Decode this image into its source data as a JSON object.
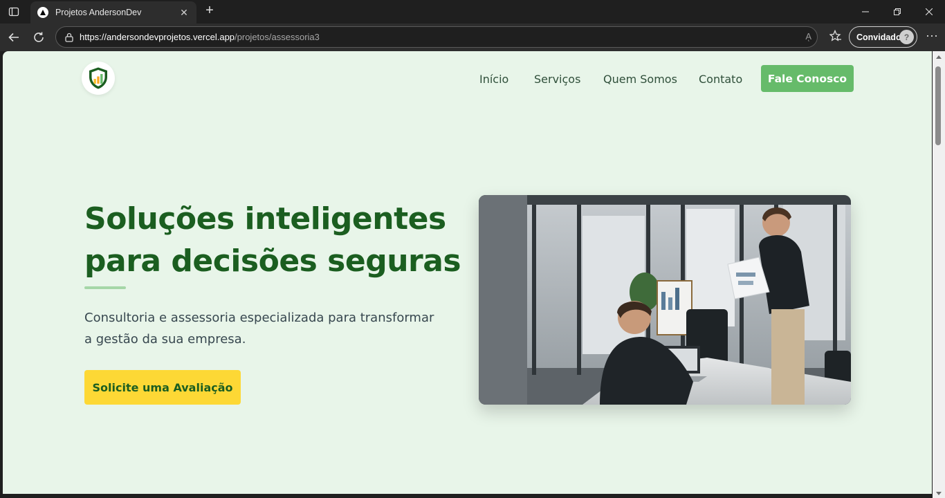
{
  "browser": {
    "tab_title": "Projetos AndersonDev",
    "url_host": "https://andersondevprojetos.vercel.app",
    "url_path": "/projetos/assessoria3",
    "read_aloud": "Aͅ",
    "profile_label": "Convidado",
    "icons": [
      "tab-actions-icon",
      "favicon-icon",
      "close-tab-icon",
      "new-tab-icon",
      "minimize-icon",
      "restore-icon",
      "close-window-icon",
      "back-icon",
      "refresh-icon",
      "lock-icon",
      "favorites-icon",
      "profile-avatar-icon",
      "more-icon"
    ]
  },
  "site": {
    "nav": {
      "items": [
        "Início",
        "Serviços",
        "Quem Somos",
        "Contato"
      ],
      "cta": "Fale Conosco"
    },
    "hero": {
      "title_line1": "Soluções inteligentes",
      "title_line2": "para decisões seguras",
      "subtitle": "Consultoria e assessoria especializada para transformar a gestão da sua empresa.",
      "button": "Solicite uma Avaliação"
    },
    "colors": {
      "background": "#e8f5e9",
      "primary": "#1b5e20",
      "accent_green": "#66bb6a",
      "accent_yellow": "#fdd835"
    }
  }
}
